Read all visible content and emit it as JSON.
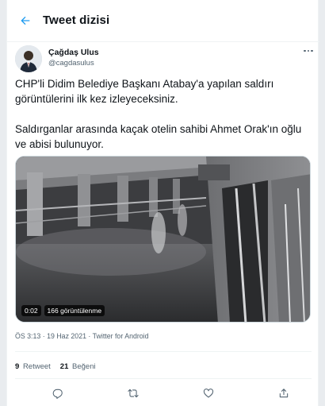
{
  "header": {
    "title": "Tweet dizisi",
    "back_icon": "arrow-left-icon"
  },
  "author": {
    "name": "Çağdaş Ulus",
    "handle": "@cagdasulus",
    "more_icon": "more-horizontal-icon"
  },
  "tweet": {
    "paragraphs": [
      "CHP'li Didim Belediye Başkanı Atabay'a yapılan saldırı görüntülerini ilk kez izleyeceksiniz.",
      "Saldırganlar arasında kaçak otelin sahibi Ahmet Orak'ın oğlu ve abisi bulunuyor."
    ]
  },
  "media": {
    "duration": "0:02",
    "views": "166 görüntülenme"
  },
  "meta": {
    "line": "ÖS 3:13 · 19 Haz 2021 · Twitter for Android"
  },
  "stats": {
    "retweets_count": "9",
    "retweets_label": "Retweet",
    "likes_count": "21",
    "likes_label": "Beğeni"
  },
  "actions": [
    "reply-icon",
    "retweet-icon",
    "like-icon",
    "share-icon"
  ],
  "colors": {
    "accent": "#1d9bf0",
    "text": "#0f1419",
    "muted": "#536471",
    "border": "#eff3f4"
  }
}
